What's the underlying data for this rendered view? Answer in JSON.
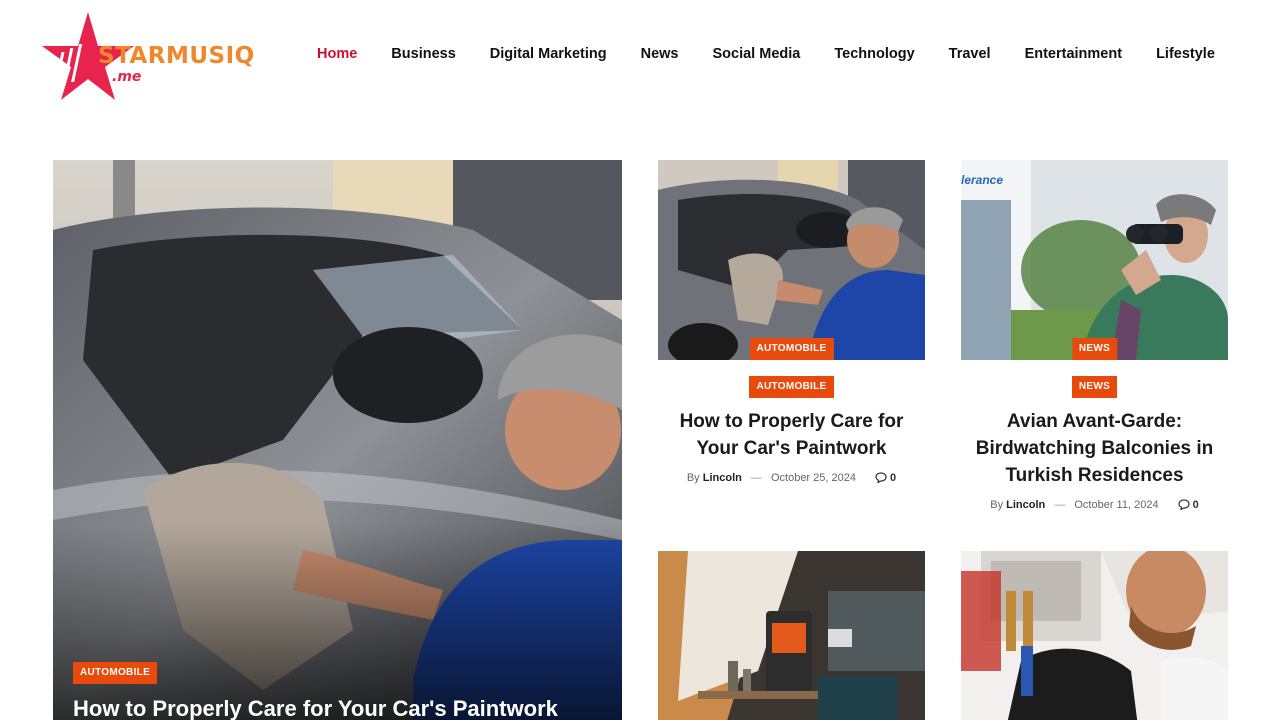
{
  "site": {
    "logo_text": "STARMUSIQ",
    "logo_suffix": ".me"
  },
  "nav": {
    "items": [
      {
        "label": "Home",
        "active": true
      },
      {
        "label": "Business"
      },
      {
        "label": "Digital Marketing"
      },
      {
        "label": "News"
      },
      {
        "label": "Social Media"
      },
      {
        "label": "Technology"
      },
      {
        "label": "Travel"
      },
      {
        "label": "Entertainment"
      },
      {
        "label": "Lifestyle"
      }
    ]
  },
  "hero": {
    "category": "AUTOMOBILE",
    "title": "How to Properly Care for Your Car's Paintwork"
  },
  "cards": [
    {
      "image_badge": "AUTOMOBILE",
      "category": "AUTOMOBILE",
      "title": "How to Properly Care for Your Car's Paintwork",
      "by": "By",
      "author": "Lincoln",
      "date": "October 25, 2024",
      "comments": "0"
    },
    {
      "image_badge": "NEWS",
      "category": "NEWS",
      "title": "Avian Avant-Garde: Birdwatching Balconies in Turkish Residences",
      "by": "By",
      "author": "Lincoln",
      "date": "October 11, 2024",
      "comments": "0"
    }
  ],
  "thumb_texts": {
    "billboard": "lerance"
  },
  "colors": {
    "accent": "#e84a0c",
    "nav_active": "#c8102e",
    "logo_orange": "#f0872a",
    "logo_red": "#e6244e"
  }
}
